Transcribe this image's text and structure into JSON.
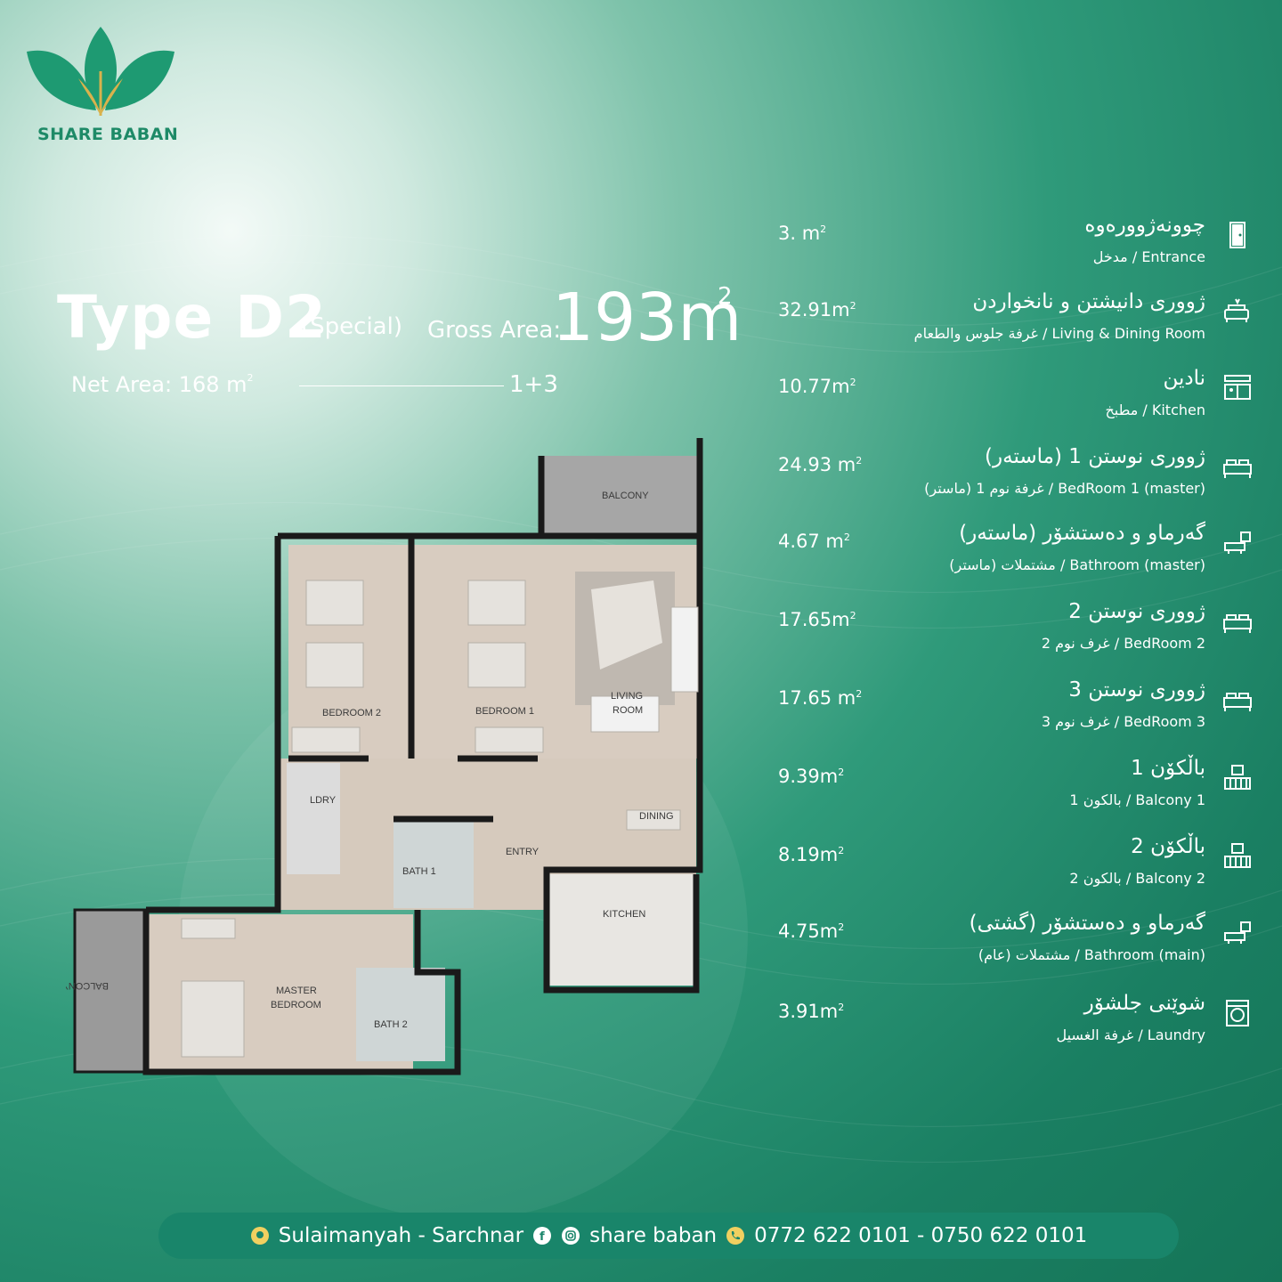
{
  "brand": {
    "name": "SHARE BABAN",
    "logo_colors": {
      "leaf": "#1e9a72",
      "gold": "#d9b24c"
    }
  },
  "header": {
    "type_label": "Type D2",
    "special_label": "(Special)",
    "gross_label": "Gross Area:",
    "gross_value": "193m",
    "gross_sup": "2",
    "net_label": "Net Area: 168 m",
    "net_sup": "2",
    "configuration": "1+3"
  },
  "rooms": [
    {
      "area": "3.   m",
      "sup": "2",
      "name_ku": "چوونەژوورەوە",
      "name_en": "مدخل / Entrance",
      "icon": "door-icon"
    },
    {
      "area": "32.91m",
      "sup": "2",
      "name_ku": "ژووری دانیشتن و نانخواردن",
      "name_en": "غرفة جلوس والطعام / Living & Dining Room",
      "icon": "living-icon"
    },
    {
      "area": "10.77m",
      "sup": "2",
      "name_ku": "نادین",
      "name_en": "مطبخ / Kitchen",
      "icon": "kitchen-icon"
    },
    {
      "area": "24.93 m",
      "sup": "2",
      "name_ku": "ژووری نوستن 1 (ماستەر)",
      "name_en": "غرفة نوم 1 (ماستر) / BedRoom 1 (master)",
      "icon": "bed-icon"
    },
    {
      "area": "4.67 m",
      "sup": "2",
      "name_ku": "گەرماو و دەستشۆر (ماستەر)",
      "name_en": "مشتملات (ماستر) / Bathroom (master)",
      "icon": "bath-icon"
    },
    {
      "area": "17.65m",
      "sup": "2",
      "name_ku": "ژووری نوستن 2",
      "name_en": "غرف نوم 2 / BedRoom 2",
      "icon": "bed-icon"
    },
    {
      "area": "17.65 m",
      "sup": "2",
      "name_ku": "ژووری نوستن 3",
      "name_en": "غرف نوم 3 / BedRoom 3",
      "icon": "bed-icon"
    },
    {
      "area": "9.39m",
      "sup": "2",
      "name_ku": "باڵکۆن 1",
      "name_en": "بالكون 1 / Balcony 1",
      "icon": "balcony-icon"
    },
    {
      "area": "8.19m",
      "sup": "2",
      "name_ku": "باڵکۆن 2",
      "name_en": "بالكون 2 / Balcony 2",
      "icon": "balcony-icon"
    },
    {
      "area": "4.75m",
      "sup": "2",
      "name_ku": "گەرماو و دەستشۆر (گشتی)",
      "name_en": "مشتملات (عام) / Bathroom (main)",
      "icon": "bath-icon"
    },
    {
      "area": "3.91m",
      "sup": "2",
      "name_ku": "شوێنی جلشۆر",
      "name_en": "غرفة الغسيل / Laundry",
      "icon": "laundry-icon"
    }
  ],
  "plan": {
    "labels": {
      "balcony_top": "BALCONY",
      "bedroom2": "BEDROOM 2",
      "bedroom1": "BEDROOM 1",
      "living1": "LIVING",
      "living2": "ROOM",
      "ldry": "LDRY",
      "dining": "DINING",
      "bath1": "BATH 1",
      "entry": "ENTRY",
      "kitchen": "KITCHEN",
      "balcony_left": "BALCONY",
      "master1": "MASTER",
      "master2": "BEDROOM",
      "bath2": "BATH 2"
    }
  },
  "footer": {
    "location": "Sulaimanyah - Sarchnar",
    "social": "share baban",
    "phones": "0772 622 0101 - 0750 622 0101"
  }
}
